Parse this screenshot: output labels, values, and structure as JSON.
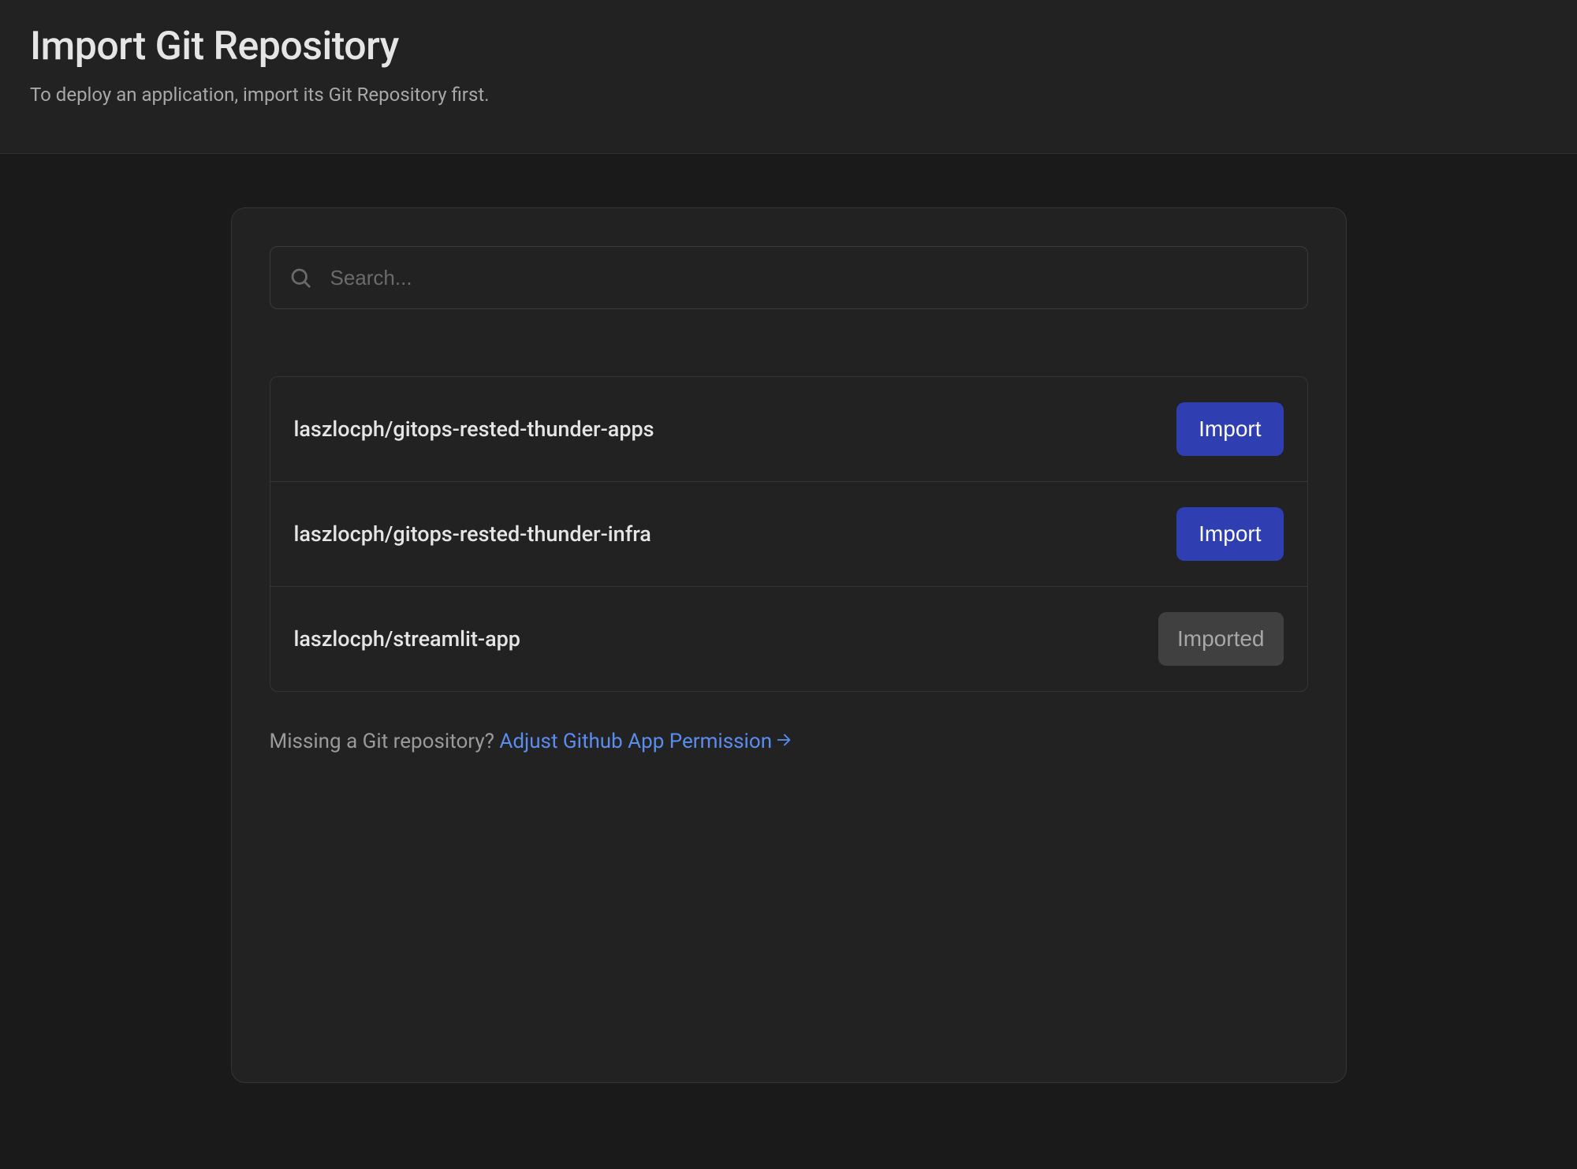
{
  "header": {
    "title": "Import Git Repository",
    "subtitle": "To deploy an application, import its Git Repository first."
  },
  "search": {
    "placeholder": "Search..."
  },
  "repos": [
    {
      "name": "laszlocph/gitops-rested-thunder-apps",
      "action_label": "Import",
      "imported": false
    },
    {
      "name": "laszlocph/gitops-rested-thunder-infra",
      "action_label": "Import",
      "imported": false
    },
    {
      "name": "laszlocph/streamlit-app",
      "action_label": "Imported",
      "imported": true
    }
  ],
  "footer": {
    "prompt": "Missing a Git repository? ",
    "link_text": "Adjust Github App Permission"
  }
}
